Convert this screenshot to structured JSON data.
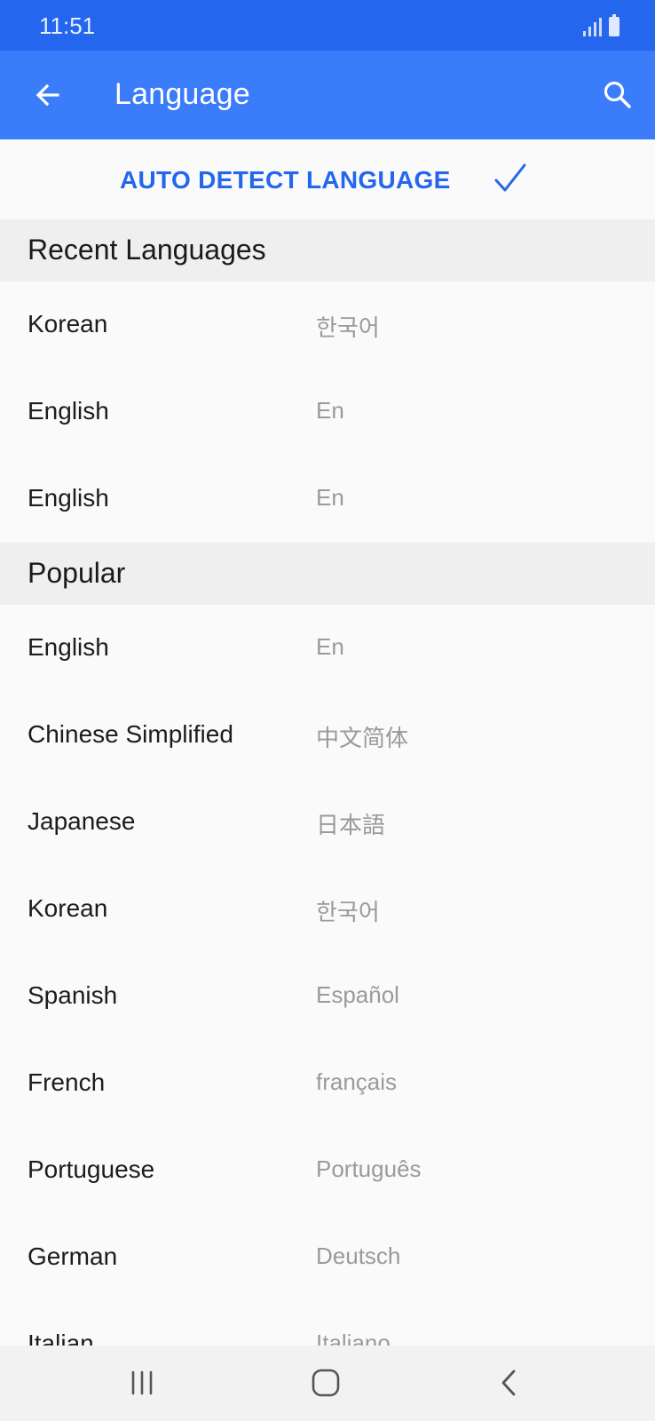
{
  "status_bar": {
    "time": "11:51"
  },
  "app_bar": {
    "title": "Language"
  },
  "auto_detect": {
    "label": "AUTO DETECT LANGUAGE"
  },
  "sections": [
    {
      "title": "Recent Languages",
      "items": [
        {
          "name": "Korean",
          "native": "한국어"
        },
        {
          "name": "English",
          "native": "En"
        },
        {
          "name": "English",
          "native": "En"
        }
      ]
    },
    {
      "title": "Popular",
      "items": [
        {
          "name": "English",
          "native": "En"
        },
        {
          "name": "Chinese Simplified",
          "native": "中文简体"
        },
        {
          "name": "Japanese",
          "native": "日本語"
        },
        {
          "name": "Korean",
          "native": "한국어"
        },
        {
          "name": "Spanish",
          "native": "Español"
        },
        {
          "name": "French",
          "native": "français"
        },
        {
          "name": "Portuguese",
          "native": "Português"
        },
        {
          "name": "German",
          "native": "Deutsch"
        },
        {
          "name": "Italian",
          "native": "Italiano"
        }
      ]
    }
  ],
  "colors": {
    "accent": "#2466ee",
    "app_bar": "#3a7cf9",
    "status_bar": "#2466ee"
  }
}
